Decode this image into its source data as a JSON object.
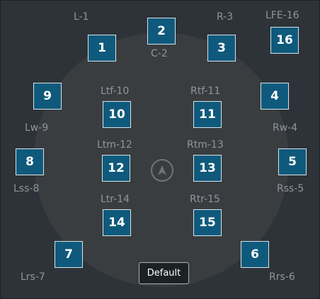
{
  "speakers": {
    "s1": {
      "num": "1",
      "label": "L-1"
    },
    "s2": {
      "num": "2",
      "label": "C-2"
    },
    "s3": {
      "num": "3",
      "label": "R-3"
    },
    "s16": {
      "num": "16",
      "label": "LFE-16"
    },
    "s9": {
      "num": "9",
      "label": "Lw-9"
    },
    "s4": {
      "num": "4",
      "label": "Rw-4"
    },
    "s10": {
      "num": "10",
      "label": "Ltf-10"
    },
    "s11": {
      "num": "11",
      "label": "Rtf-11"
    },
    "s8": {
      "num": "8",
      "label": "Lss-8"
    },
    "s5": {
      "num": "5",
      "label": "Rss-5"
    },
    "s12": {
      "num": "12",
      "label": "Ltm-12"
    },
    "s13": {
      "num": "13",
      "label": "Rtm-13"
    },
    "s14": {
      "num": "14",
      "label": "Ltr-14"
    },
    "s15": {
      "num": "15",
      "label": "Rtr-15"
    },
    "s7": {
      "num": "7",
      "label": "Lrs-7"
    },
    "s6": {
      "num": "6",
      "label": "Rrs-6"
    }
  },
  "center_icon": "listener-position-icon",
  "default_button": {
    "label": "Default"
  },
  "colors": {
    "background": "#2d3338",
    "circle": "#3a3d40",
    "speaker_fill": "#0f5a7c",
    "speaker_border": "#d8e4ea",
    "label": "#8f969c"
  }
}
